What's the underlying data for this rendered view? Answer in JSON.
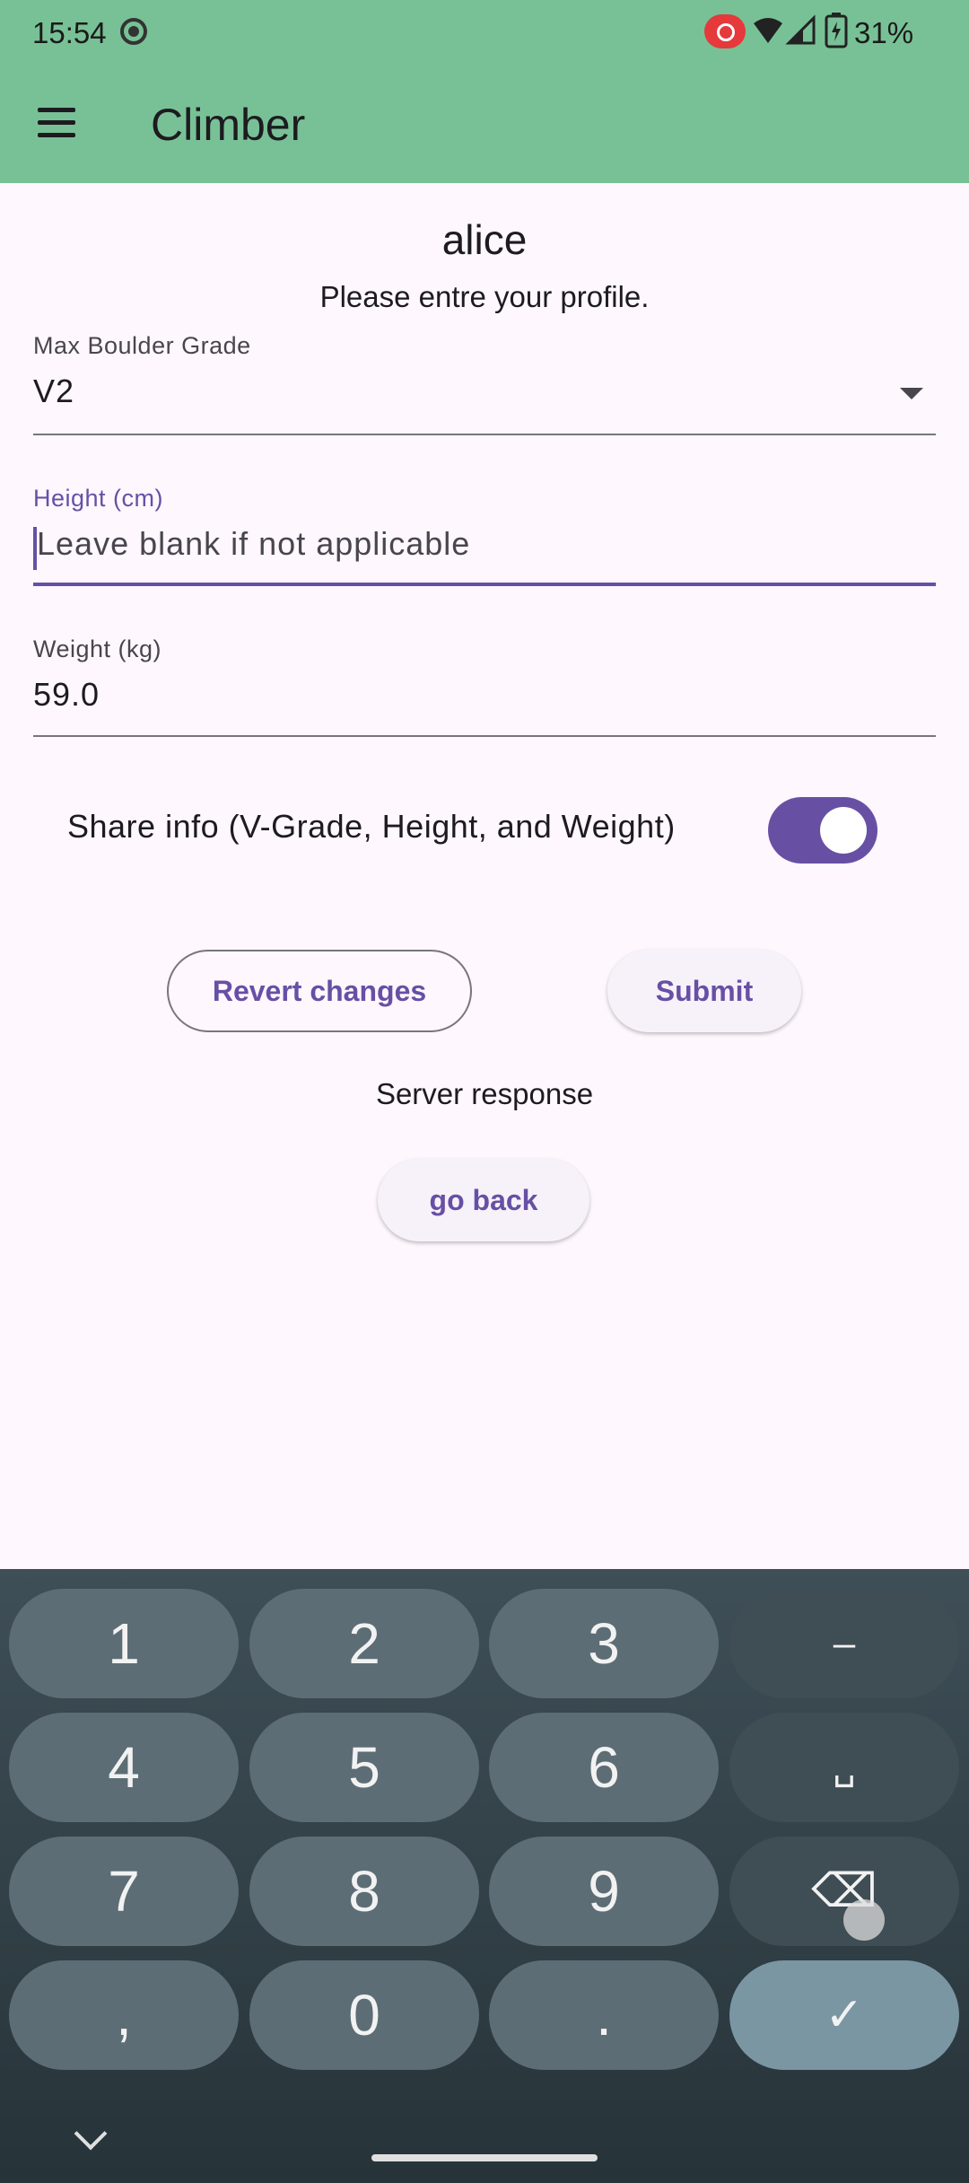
{
  "status_bar": {
    "time": "15:54",
    "battery": "31%"
  },
  "app_bar": {
    "title": "Climber"
  },
  "profile": {
    "username": "alice",
    "subtitle": "Please entre your profile."
  },
  "form": {
    "grade": {
      "label": "Max Boulder Grade",
      "value": "V2"
    },
    "height": {
      "label": "Height (cm)",
      "placeholder": "Leave blank if not applicable"
    },
    "weight": {
      "label": "Weight (kg)",
      "value": "59.0"
    },
    "share": {
      "label": "Share info (V-Grade, Height, and Weight)",
      "on": true
    }
  },
  "buttons": {
    "revert": "Revert changes",
    "submit": "Submit",
    "go_back": "go back"
  },
  "server_response": "Server response",
  "keyboard": {
    "rows": [
      [
        "1",
        "2",
        "3",
        "–"
      ],
      [
        "4",
        "5",
        "6",
        "␣"
      ],
      [
        "7",
        "8",
        "9",
        "⌫"
      ],
      [
        ",",
        "0",
        ".",
        "✓"
      ]
    ]
  },
  "colors": {
    "appbar": "#78c196",
    "accent": "#6750a4",
    "background": "#fef7fe"
  }
}
